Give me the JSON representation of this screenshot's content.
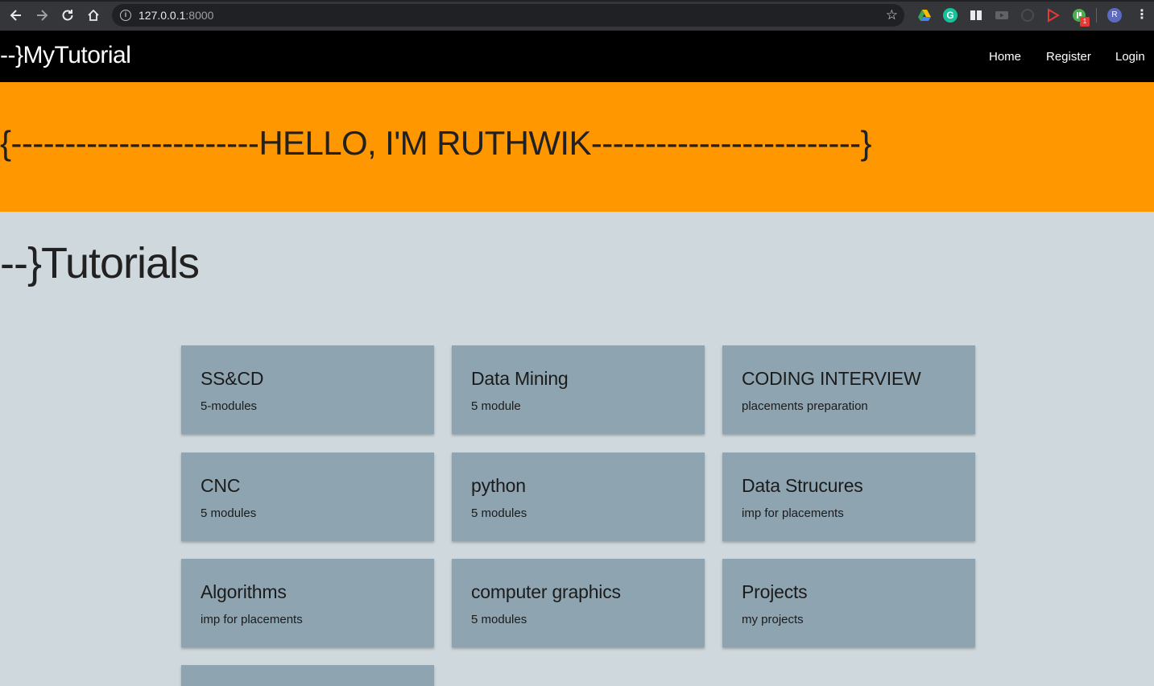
{
  "browser": {
    "url_host": "127.0.0.1",
    "url_port": ":8000",
    "avatar_letter": "R",
    "extension_badge": "1"
  },
  "navbar": {
    "brand": "--}MyTutorial",
    "links": [
      "Home",
      "Register",
      "Login"
    ]
  },
  "hero": {
    "text": "{-----------------------HELLO, I'M RUTHWIK-------------------------}"
  },
  "tutorials": {
    "title": "--}Tutorials",
    "cards": [
      {
        "title": "SS&CD",
        "subtitle": "5-modules"
      },
      {
        "title": "Data Mining",
        "subtitle": "5 module"
      },
      {
        "title": "CODING INTERVIEW",
        "subtitle": "placements preparation"
      },
      {
        "title": "CNC",
        "subtitle": "5 modules"
      },
      {
        "title": "python",
        "subtitle": "5 modules"
      },
      {
        "title": "Data Strucures",
        "subtitle": "imp for placements"
      },
      {
        "title": "Algorithms",
        "subtitle": "imp for placements"
      },
      {
        "title": "computer graphics",
        "subtitle": "5 modules"
      },
      {
        "title": "Projects",
        "subtitle": "my projects"
      },
      {
        "title": "",
        "subtitle": ""
      }
    ]
  }
}
